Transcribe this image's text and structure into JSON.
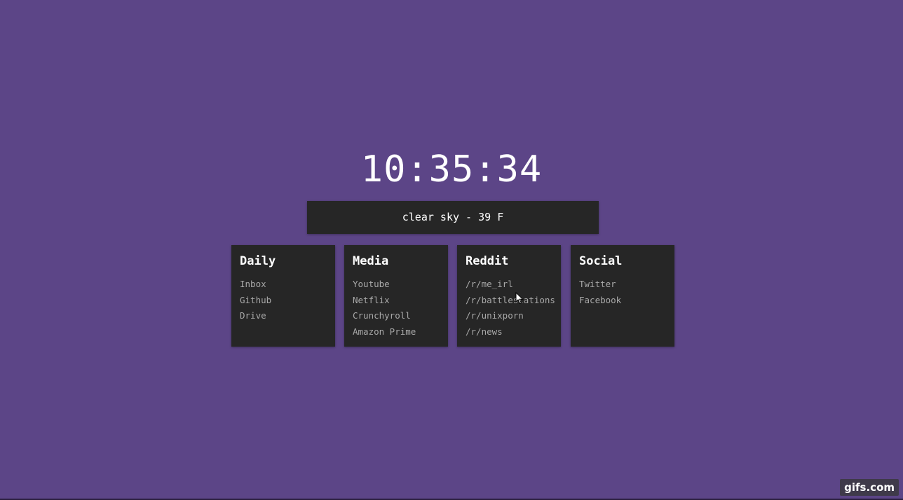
{
  "clock": {
    "time": "10:35:34"
  },
  "weather": {
    "text": "clear sky - 39 F"
  },
  "cards": {
    "daily": {
      "title": "Daily",
      "links": [
        "Inbox",
        "Github",
        "Drive"
      ]
    },
    "media": {
      "title": "Media",
      "links": [
        "Youtube",
        "Netflix",
        "Crunchyroll",
        "Amazon Prime"
      ]
    },
    "reddit": {
      "title": "Reddit",
      "links": [
        "/r/me_irl",
        "/r/battlestations",
        "/r/unixporn",
        "/r/news"
      ]
    },
    "social": {
      "title": "Social",
      "links": [
        "Twitter",
        "Facebook"
      ]
    }
  },
  "watermark": {
    "text": "gifs.com"
  },
  "colors": {
    "background": "#5c4587",
    "card": "#262626",
    "title": "#ffffff",
    "link": "#a9a9a9"
  }
}
